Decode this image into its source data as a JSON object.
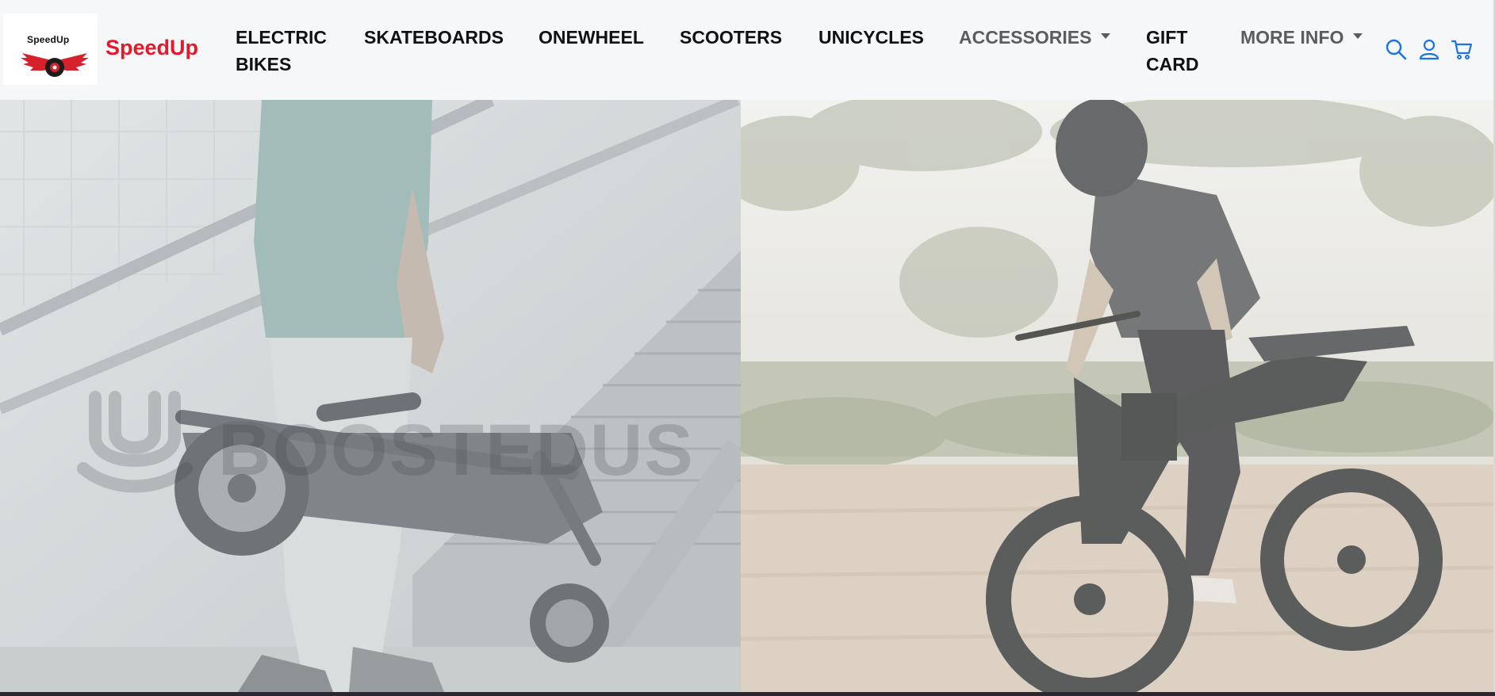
{
  "header": {
    "logo_text": "SpeedUp",
    "brand_name": "SpeedUp",
    "brand_color": "#e21b2c"
  },
  "nav": {
    "items": [
      {
        "line1": "ELECTRIC",
        "line2": "BIKES"
      },
      {
        "line1": "SKATEBOARDS"
      },
      {
        "line1": "ONEWHEEL"
      },
      {
        "line1": "SCOOTERS"
      },
      {
        "line1": "UNICYCLES"
      },
      {
        "line1": "ACCESSORIES"
      },
      {
        "line1": "GIFT",
        "line2": "CARD"
      },
      {
        "line1": "MORE INFO"
      }
    ],
    "icons": [
      "search-icon",
      "user-icon",
      "cart-icon"
    ],
    "icon_color": "#1a73e8"
  },
  "hero": {
    "left_watermark": "BOOSTEDUS"
  }
}
